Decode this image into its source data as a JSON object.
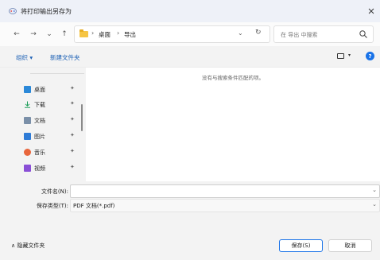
{
  "window": {
    "title": "将打印输出另存为",
    "close_icon": "close-icon"
  },
  "nav": {
    "back_icon": "←",
    "forward_icon": "→",
    "recent_icon": "⌄",
    "up_icon": "↑",
    "breadcrumbs": [
      "桌面",
      "导出"
    ],
    "breadcrumb_sep": "›",
    "address_dropdown": "⌄",
    "refresh_icon": "↻",
    "search_placeholder": "在 导出 中搜索"
  },
  "toolbar": {
    "organize_label": "组织 ▾",
    "new_folder_label": "新建文件夹",
    "view_dropdown": "▾",
    "help_icon": "?"
  },
  "sidebar": {
    "items": [
      {
        "label": "桌面",
        "icon": "desktop-icon",
        "color": "#2b88d8",
        "pin": "📌"
      },
      {
        "label": "下载",
        "icon": "download-icon",
        "color": "#1e9e5a",
        "pin": "📌"
      },
      {
        "label": "文档",
        "icon": "document-icon",
        "color": "#7a8fa8",
        "pin": "📌"
      },
      {
        "label": "图片",
        "icon": "pictures-icon",
        "color": "#2e7bd6",
        "pin": "📌"
      },
      {
        "label": "音乐",
        "icon": "music-icon",
        "color": "#e8663c",
        "pin": "📌"
      },
      {
        "label": "视频",
        "icon": "video-icon",
        "color": "#8a4fd6",
        "pin": "📌"
      }
    ]
  },
  "content": {
    "empty_message": "没有与搜索条件匹配的项。"
  },
  "form": {
    "filename_label": "文件名(N):",
    "filename_value": "",
    "filetype_label": "保存类型(T):",
    "filetype_value": "PDF 文档(*.pdf)",
    "dropdown": "⌄"
  },
  "footer": {
    "hide_folders_label": "∧  隐藏文件夹",
    "save_label": "保存(S)",
    "cancel_label": "取消"
  },
  "colors": {
    "accent": "#1a73e8",
    "folder": "#f6c544"
  }
}
